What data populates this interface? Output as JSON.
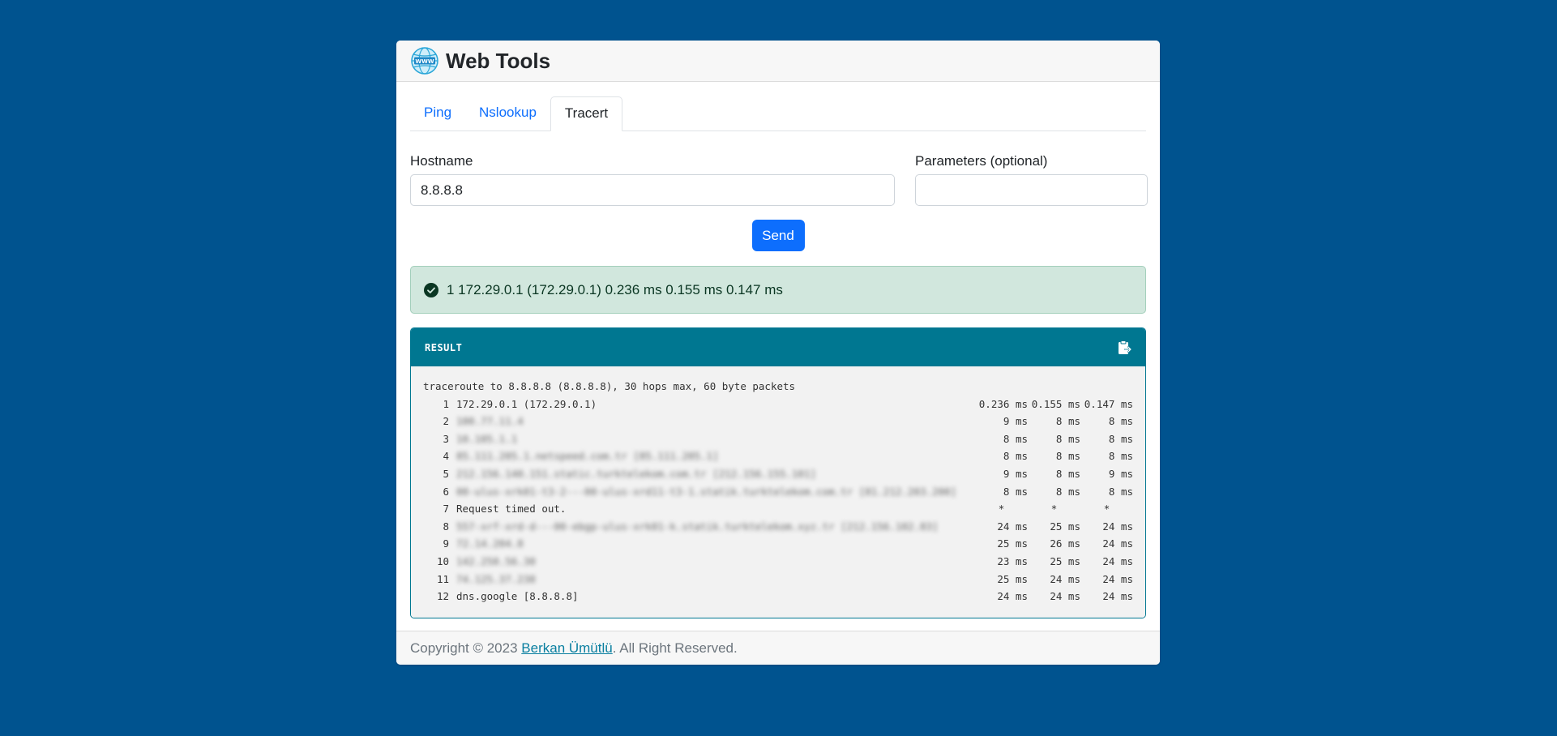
{
  "header": {
    "title": "Web Tools"
  },
  "tabs": [
    {
      "label": "Ping"
    },
    {
      "label": "Nslookup"
    },
    {
      "label": "Tracert"
    }
  ],
  "form": {
    "hostname_label": "Hostname",
    "hostname_value": "8.8.8.8",
    "params_label": "Parameters (optional)",
    "params_value": "",
    "send_label": "Send"
  },
  "alert": {
    "text": "1 172.29.0.1 (172.29.0.1) 0.236 ms 0.155 ms 0.147 ms"
  },
  "result": {
    "title": "RESULT",
    "header_line": "traceroute to 8.8.8.8 (8.8.8.8), 30 hops max, 60 byte packets",
    "hops": [
      {
        "n": "1",
        "host": "172.29.0.1 (172.29.0.1)",
        "t1": "0.236 ms",
        "t2": "0.155 ms",
        "t3": "0.147 ms",
        "blurred": false
      },
      {
        "n": "2",
        "host": "100.77.11.4",
        "t1": "9 ms",
        "t2": "8 ms",
        "t3": "8 ms",
        "blurred": true
      },
      {
        "n": "3",
        "host": "10.105.1.1",
        "t1": "8 ms",
        "t2": "8 ms",
        "t3": "8 ms",
        "blurred": true
      },
      {
        "n": "4",
        "host": "85.111.205.1.netspeed.com.tr [85.111.205.1]",
        "t1": "8 ms",
        "t2": "8 ms",
        "t3": "8 ms",
        "blurred": true
      },
      {
        "n": "5",
        "host": "212.156.140.151.static.turktelekom.com.tr [212.156.155.101]",
        "t1": "9 ms",
        "t2": "8 ms",
        "t3": "9 ms",
        "blurred": true
      },
      {
        "n": "6",
        "host": "00-ulus-xrk01-t3-2---00-ulus-xrd11-t3-1.statik.turktelekom.com.tr [81.212.203.200]",
        "t1": "8 ms",
        "t2": "8 ms",
        "t3": "8 ms",
        "blurred": true
      },
      {
        "n": "7",
        "host": "Request timed out.",
        "t1": "*",
        "t2": "*",
        "t3": "*",
        "blurred": false
      },
      {
        "n": "8",
        "host": "557-xrf-xrd-d---00-ebgp-ulus-xrk01-k.statik.turktelekom.xyz.tr [212.156.102.83]",
        "t1": "24 ms",
        "t2": "25 ms",
        "t3": "24 ms",
        "blurred": true
      },
      {
        "n": "9",
        "host": "72.14.204.8",
        "t1": "25 ms",
        "t2": "26 ms",
        "t3": "24 ms",
        "blurred": true
      },
      {
        "n": "10",
        "host": "142.250.56.30",
        "t1": "23 ms",
        "t2": "25 ms",
        "t3": "24 ms",
        "blurred": true
      },
      {
        "n": "11",
        "host": "74.125.37.238",
        "t1": "25 ms",
        "t2": "24 ms",
        "t3": "24 ms",
        "blurred": true
      },
      {
        "n": "12",
        "host": "dns.google [8.8.8.8]",
        "t1": "24 ms",
        "t2": "24 ms",
        "t3": "24 ms",
        "blurred": false
      }
    ]
  },
  "footer": {
    "prefix": "Copyright © 2023 ",
    "author": "Berkan Ümütlü",
    "suffix": ". All Right Reserved."
  },
  "colors": {
    "background": "#00538f",
    "primary": "#0d6efd",
    "result_header": "#007791",
    "alert_bg": "#d1e7dd"
  }
}
